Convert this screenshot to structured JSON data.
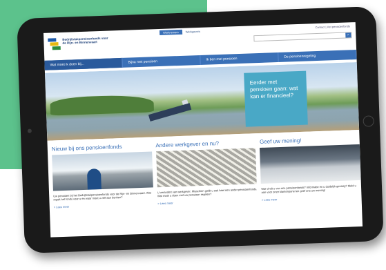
{
  "logo_text": "Bedrijfstakpensioenfonds voor de Rijn- en Binnenvaart",
  "top_tabs": [
    "Werknemers",
    "Werkgevers"
  ],
  "utility_links": "Contact | Het pensioenfonds",
  "nav": [
    "Wat moet ik doen bij...",
    "Bijna met pensioen",
    "Ik ben met pensioen",
    "De pensioenregeling"
  ],
  "hero_callout": "Eerder met pensioen gaan: wat kan er financieel?",
  "cards": [
    {
      "title": "Nieuw bij ons pensioenfonds",
      "text": "Uw pensioen bij het Bedrijfstakpensioenfonds voor de Rijn- en Binnenvaart. Wat regelt het fonds voor u en waar moet u zelf aan denken?",
      "more": "> Lees meer"
    },
    {
      "title": "Andere werkgever en nu?",
      "text": "U verandert van werkgever. Misschien geldt u ook heel een ander pensioenfonds. Wat moet u doen met uw pensioen regelen?",
      "more": "> Lees meer"
    },
    {
      "title": "Geef uw mening!",
      "text": "Wat vindt u van ons pensioenfonds? Informatie en u duidelijk genoeg? Meld u aan voor onze klantenpanel en geef ons uw mening!",
      "more": "> Lees meer"
    }
  ]
}
